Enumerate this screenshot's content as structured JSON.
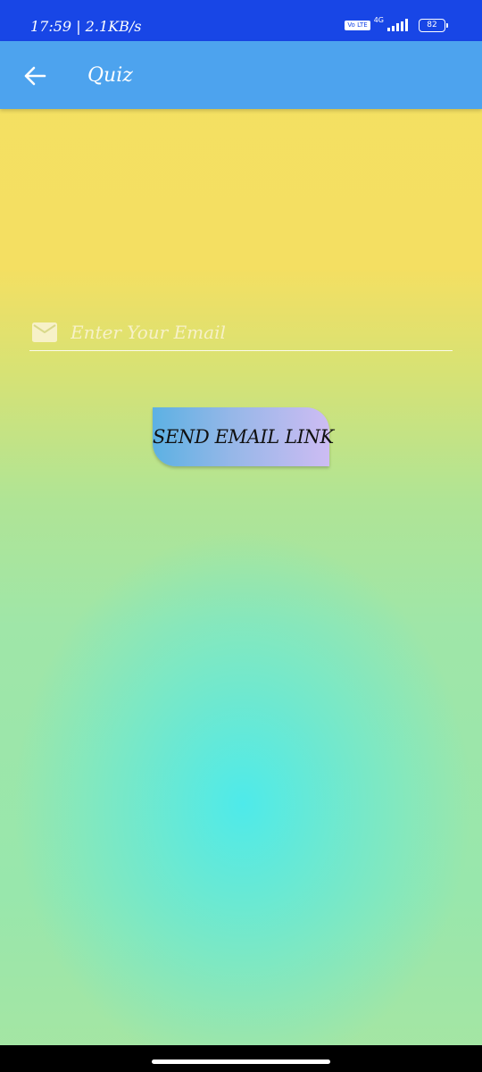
{
  "status_bar": {
    "time_speed": "17:59 | 2.1KB/s",
    "volte_label": "Vo LTE",
    "network_type": "4G",
    "battery_level": "82"
  },
  "app_bar": {
    "title": "Quiz",
    "back_icon": "arrow-left-icon"
  },
  "email_form": {
    "email_icon": "mail-icon",
    "email_placeholder": "Enter Your Email",
    "email_value": "",
    "send_button_label": "SEND EMAIL LINK"
  },
  "colors": {
    "status_bar": "#1846e6",
    "app_bar": "#4da3ee",
    "background_top": "#f3e062",
    "background_center": "#4eeaea",
    "button_start": "#5cb1e3",
    "button_end": "#cdbcf3"
  }
}
